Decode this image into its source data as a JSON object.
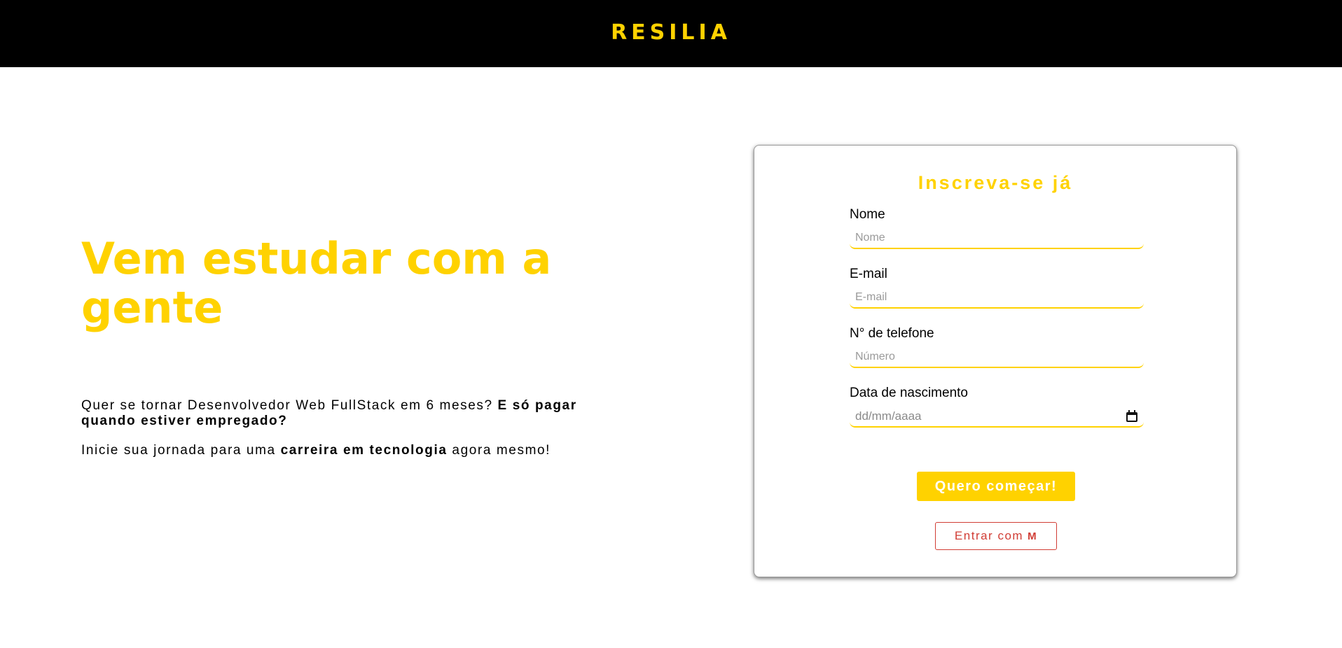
{
  "header": {
    "logo": "RESILIA"
  },
  "hero": {
    "title": "Vem estudar com a gente",
    "p1_text": "Quer se tornar Desenvolvedor Web FullStack em 6 meses? ",
    "p1_bold": "E só pagar quando estiver empregado?",
    "p2_pre": "Inicie sua jornada para uma ",
    "p2_bold": "carreira em tecnologia",
    "p2_post": " agora mesmo!"
  },
  "form": {
    "title": "Inscreva-se já",
    "fields": [
      {
        "label": "Nome",
        "placeholder": "Nome"
      },
      {
        "label": "E-mail",
        "placeholder": "E-mail"
      },
      {
        "label": "N° de telefone",
        "placeholder": "Número"
      },
      {
        "label": "Data de nascimento",
        "placeholder": "dd/mm/aaaa"
      }
    ],
    "submit_label": "Quero começar!",
    "gmail_label": "Entrar com",
    "gmail_icon": "M"
  },
  "colors": {
    "accent": "#ffd200",
    "header_bg": "#000000",
    "gmail_red": "#d13d35"
  }
}
